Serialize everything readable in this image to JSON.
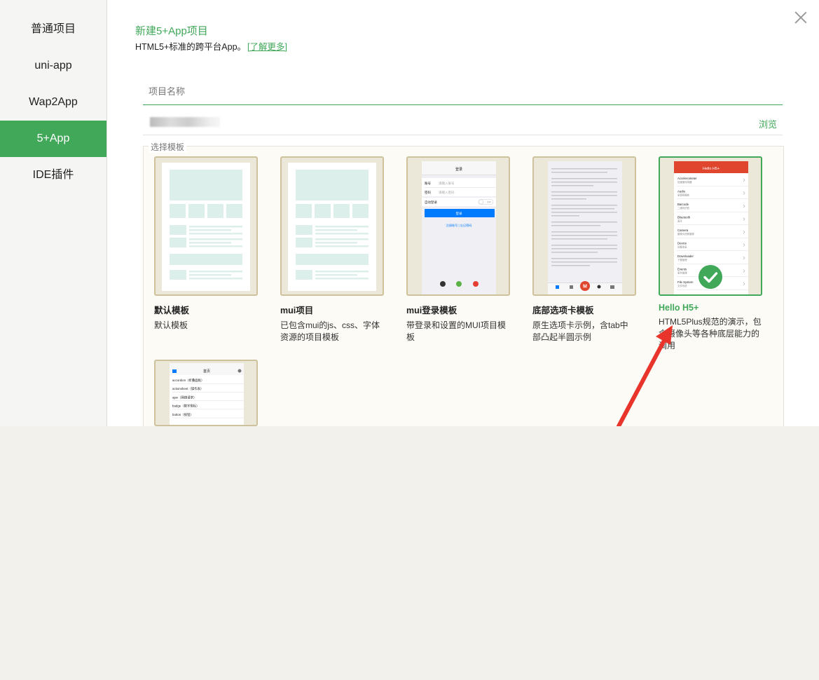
{
  "sidebar": {
    "items": [
      "普通项目",
      "uni-app",
      "Wap2App",
      "5+App",
      "IDE插件"
    ],
    "active": "5+App"
  },
  "header": {
    "title": "新建5+App项目",
    "subtitle": "HTML5+标准的跨平台App。",
    "learn_more": "[了解更多]"
  },
  "form": {
    "name_placeholder": "项目名称",
    "browse": "浏览"
  },
  "templates": {
    "legend": "选择模板",
    "items": [
      {
        "title": "默认模板",
        "desc": "默认模板"
      },
      {
        "title": "mui项目",
        "desc": "已包含mui的js、css、字体资源的项目模板"
      },
      {
        "title": "mui登录模板",
        "desc": "带登录和设置的MUI项目模板"
      },
      {
        "title": "底部选项卡模板",
        "desc": "原生选项卡示例，含tab中部凸起半圆示例"
      },
      {
        "title": "Hello H5+",
        "desc": "HTML5Plus规范的演示，包含摄像头等各种底层能力的调用",
        "selected": true
      }
    ],
    "mui_login": {
      "nav_title": "登录",
      "account_label": "账号",
      "account_hint": "请输入账号",
      "pwd_label": "密码",
      "pwd_hint": "请输入密码",
      "auto_login": "自动登录",
      "toggle": "OFF",
      "login_btn": "登录",
      "links": "注册账号 | 忘记密码"
    },
    "hello_h5": {
      "nav_title": "Hello H5+",
      "items": [
        [
          "Accelerometer",
          "加速度传感器"
        ],
        [
          "Audio",
          "录音和播放"
        ],
        [
          "Barcode",
          "二维码识别"
        ],
        [
          "Bluetooth",
          "蓝牙"
        ],
        [
          "Camera",
          "摄像头拍照摄像"
        ],
        [
          "Device",
          "设备信息"
        ],
        [
          "Downloader",
          "下载管理"
        ],
        [
          "Events",
          "事件管理"
        ],
        [
          "File System",
          "文件系统"
        ]
      ]
    },
    "tabbar": {
      "center": "M"
    },
    "mui_index": {
      "nav_title": "首页",
      "items": [
        "accordion（折叠面板）",
        "actionsheet（操作表）",
        "ajax（网络请求）",
        "badge（数字角标）",
        "button（按钮）"
      ]
    }
  },
  "colors": {
    "accent": "#41a85a",
    "arrow": "#e8342b",
    "check": "#41a85a"
  }
}
